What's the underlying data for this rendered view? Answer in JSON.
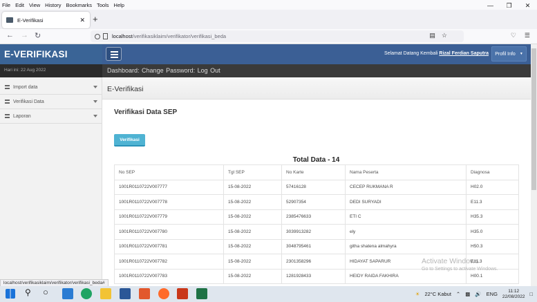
{
  "browser": {
    "menu": [
      "File",
      "Edit",
      "View",
      "History",
      "Bookmarks",
      "Tools",
      "Help"
    ],
    "tab_title": "E-Verifikasi",
    "url_host": "localhost",
    "url_path": "/verifikasiklaim/verifikator/verifikasi_beda",
    "status_url": "localhost/verifikasiklaim/verifikator/verifikasi_beda#"
  },
  "app": {
    "brand": "E-VERIFIKASI",
    "welcome_prefix": "Selamat Datang Kembali",
    "user_name": "Rizal Ferdian Saputra",
    "profile_label": "Profil Info",
    "date_label": "Hari ini: 22 Aug 2022",
    "topnav": [
      "Dashboard",
      "Change Password",
      "Log Out"
    ],
    "sidebar": [
      {
        "label": "Import data"
      },
      {
        "label": "Verifikasi Data"
      },
      {
        "label": "Laporan"
      }
    ],
    "breadcrumb": "E-Verifikasi",
    "section_title": "Verifikasi Data SEP",
    "verify_button": "Verifikasi",
    "total_label": "Total Data - 14"
  },
  "table": {
    "headers": [
      "No SEP",
      "Tgl SEP",
      "No Karte",
      "Nama Peserta",
      "Diagnosa"
    ],
    "rows": [
      [
        "1001R0110722V007777",
        "15-08-2022",
        "57416128",
        "CECEP RUKMANA R",
        "H02.0"
      ],
      [
        "1001R0110722V007778",
        "15-08-2022",
        "52907354",
        "DEDI SURYADI",
        "E11.3"
      ],
      [
        "1001R0110722V007779",
        "15-08-2022",
        "2385476633",
        "ETI C",
        "H35.3"
      ],
      [
        "1001R0110722V007780",
        "15-08-2022",
        "3039913282",
        "ely",
        "H35.0"
      ],
      [
        "1001R0110722V007781",
        "15-08-2022",
        "3048795461",
        "githa shatena almahyra",
        "H50.3"
      ],
      [
        "1001R0110722V007782",
        "15-08-2022",
        "2301358296",
        "HIDAYAT SAPARUR",
        "E11.3"
      ],
      [
        "1001R0110722V007783",
        "15-08-2022",
        "1281928433",
        "HEIDY RAIDA FAKHIRA",
        "H00.1"
      ]
    ]
  },
  "overlay": {
    "activate_title": "Activate Windows",
    "activate_sub": "Go to Settings to activate Windows."
  },
  "taskbar": {
    "weather": "22°C  Kabut",
    "lang": "ENG",
    "time": "11:12",
    "date": "22/08/2022"
  },
  "colors": {
    "brand_bg": "#3a6496",
    "topbar_bg": "#3b5f95",
    "button_accent": "#4fb3d3"
  }
}
